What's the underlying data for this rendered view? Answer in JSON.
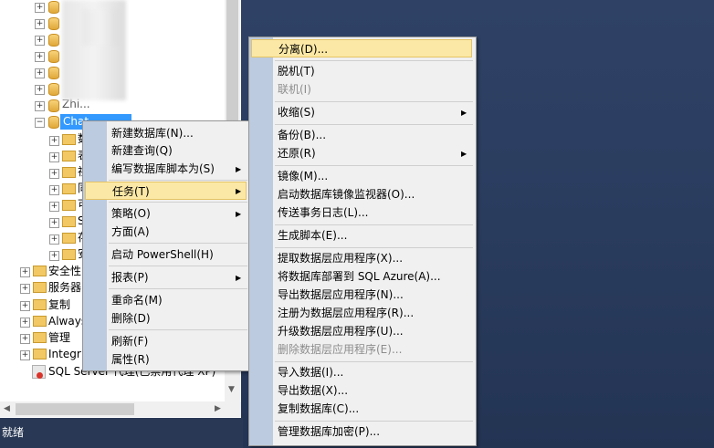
{
  "status_bar": {
    "text": "就绪"
  },
  "explorer": {
    "obscured_db_label": "Zhi...",
    "selected_node": "Chat...",
    "child_folders": [
      "数",
      "表",
      "视",
      "同",
      "可",
      "S",
      "存",
      "安"
    ],
    "server_nodes": [
      "安全性",
      "服务器",
      "复制",
      "Always",
      "管理",
      "Integr"
    ],
    "agent_node": "SQL Server 代理(已禁用代理 XP)"
  },
  "context_menu": {
    "items": [
      "新建数据库(N)...",
      "新建查询(Q)",
      "编写数据库脚本为(S)",
      "任务(T)",
      "策略(O)",
      "方面(A)",
      "启动 PowerShell(H)",
      "报表(P)",
      "重命名(M)",
      "删除(D)",
      "刷新(F)",
      "属性(R)"
    ]
  },
  "tasks_menu": {
    "items": [
      "分离(D)...",
      "脱机(T)",
      "联机(I)",
      "收缩(S)",
      "备份(B)...",
      "还原(R)",
      "镜像(M)...",
      "启动数据库镜像监视器(O)...",
      "传送事务日志(L)...",
      "生成脚本(E)...",
      "提取数据层应用程序(X)...",
      "将数据库部署到 SQL Azure(A)...",
      "导出数据层应用程序(N)...",
      "注册为数据层应用程序(R)...",
      "升级数据层应用程序(U)...",
      "删除数据层应用程序(E)...",
      "导入数据(I)...",
      "导出数据(X)...",
      "复制数据库(C)...",
      "管理数据库加密(P)..."
    ]
  }
}
